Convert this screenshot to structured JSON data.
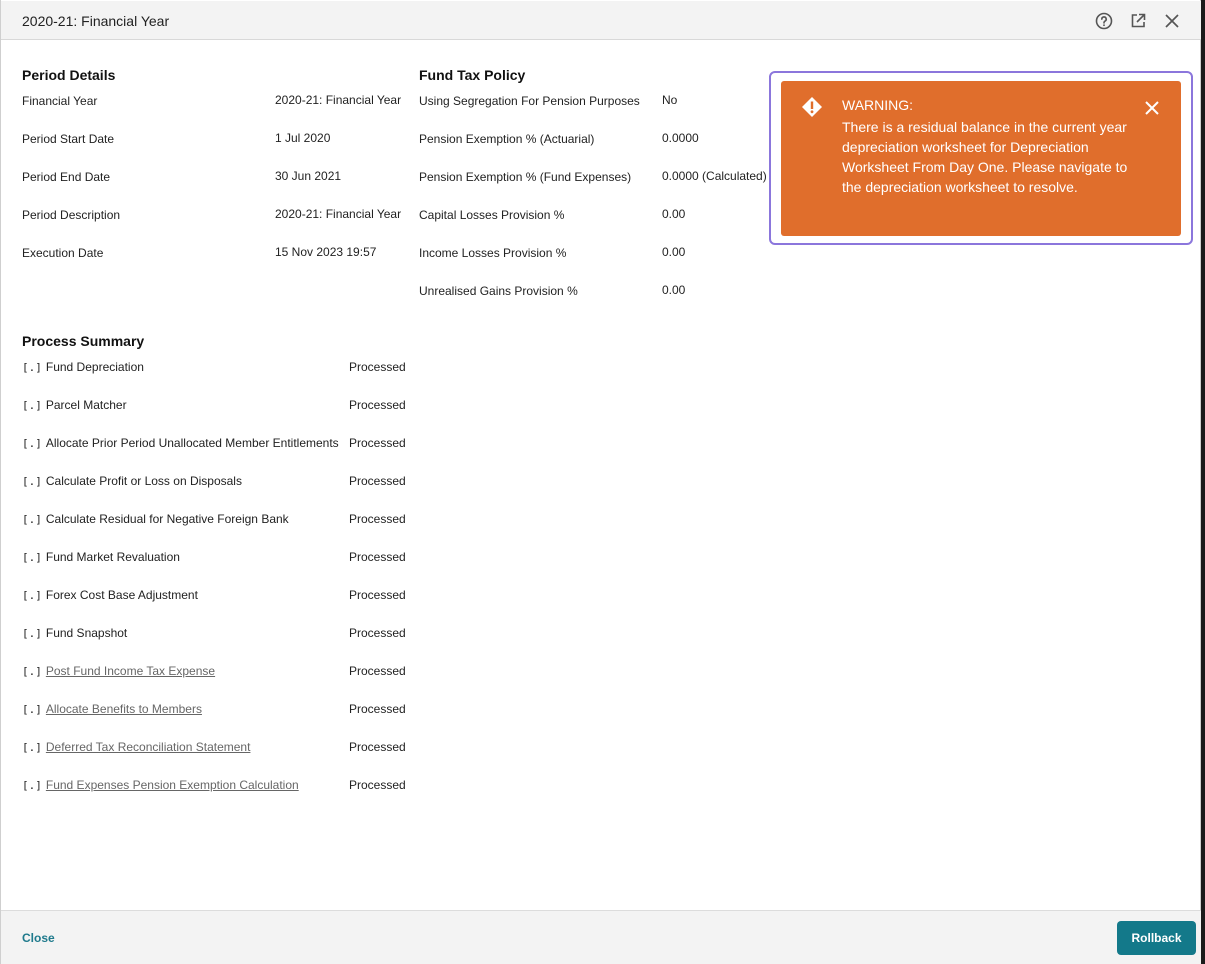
{
  "window": {
    "title": "2020-21: Financial Year"
  },
  "header_icons": [
    "help-circle-icon",
    "external-link-icon",
    "close-icon"
  ],
  "period_details": {
    "title": "Period Details",
    "rows": [
      {
        "label": "Financial Year",
        "value": "2020-21: Financial Year"
      },
      {
        "label": "Period Start Date",
        "value": "1 Jul 2020"
      },
      {
        "label": "Period End Date",
        "value": "30 Jun 2021"
      },
      {
        "label": "Period Description",
        "value": "2020-21: Financial Year"
      },
      {
        "label": "Execution Date",
        "value": "15 Nov 2023 19:57"
      }
    ]
  },
  "fund_tax_policy": {
    "title": "Fund Tax Policy",
    "rows": [
      {
        "label": "Using Segregation For Pension Purposes",
        "value": "No"
      },
      {
        "label": "Pension Exemption % (Actuarial)",
        "value": "0.0000"
      },
      {
        "label": "Pension Exemption % (Fund Expenses)",
        "value": "0.0000 (Calculated)"
      },
      {
        "label": "Capital Losses Provision %",
        "value": "0.00"
      },
      {
        "label": "Income Losses Provision %",
        "value": "0.00"
      },
      {
        "label": "Unrealised Gains Provision %",
        "value": "0.00"
      }
    ]
  },
  "process_summary": {
    "title": "Process Summary",
    "bracket": "[.]",
    "items": [
      {
        "name": "Fund Depreciation",
        "status": "Processed",
        "link": false
      },
      {
        "name": "Parcel Matcher",
        "status": "Processed",
        "link": false
      },
      {
        "name": "Allocate Prior Period Unallocated Member Entitlements",
        "status": "Processed",
        "link": false
      },
      {
        "name": "Calculate Profit or Loss on Disposals",
        "status": "Processed",
        "link": false
      },
      {
        "name": "Calculate Residual for Negative Foreign Bank",
        "status": "Processed",
        "link": false
      },
      {
        "name": "Fund Market Revaluation",
        "status": "Processed",
        "link": false
      },
      {
        "name": "Forex Cost Base Adjustment",
        "status": "Processed",
        "link": false
      },
      {
        "name": "Fund Snapshot",
        "status": "Processed",
        "link": false
      },
      {
        "name": "Post Fund Income Tax Expense",
        "status": "Processed",
        "link": true
      },
      {
        "name": "Allocate Benefits to Members",
        "status": "Processed",
        "link": true
      },
      {
        "name": "Deferred Tax Reconciliation Statement",
        "status": "Processed",
        "link": true
      },
      {
        "name": "Fund Expenses Pension Exemption Calculation",
        "status": "Processed",
        "link": true
      }
    ]
  },
  "warning": {
    "heading": "WARNING:",
    "message": "There is a residual balance in the current year depreciation worksheet for Depreciation Worksheet From Day One. Please navigate to the depreciation worksheet to resolve.",
    "color": "#e06e2c",
    "highlight_color": "#8b76dc"
  },
  "footer": {
    "close_label": "Close",
    "rollback_label": "Rollback"
  },
  "colors": {
    "accent": "#13798a",
    "link": "#1f7a8c"
  }
}
